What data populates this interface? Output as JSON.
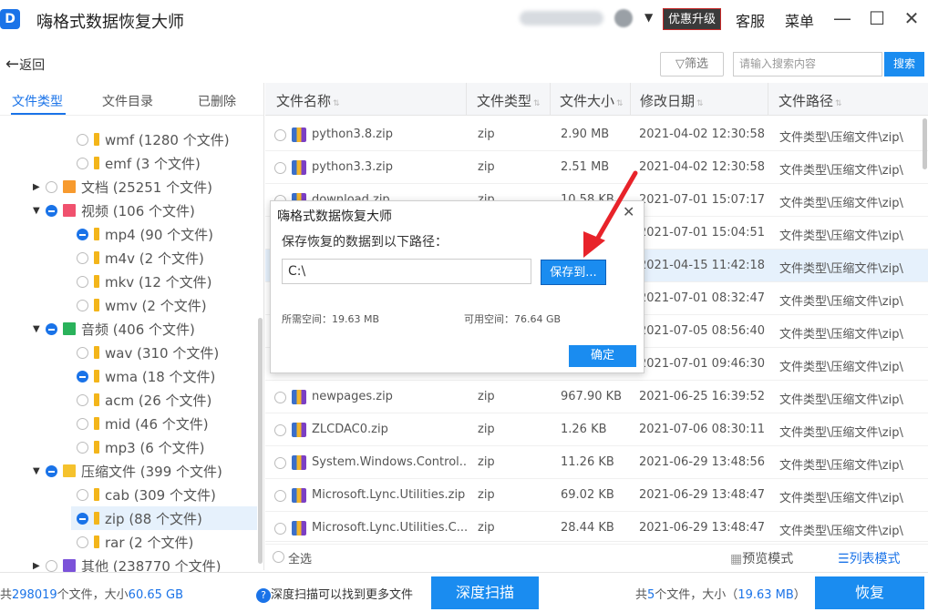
{
  "titlebar": {
    "app_title": "嗨格式数据恢复大师",
    "promo_label": "优惠升级",
    "service_label": "客服",
    "menu_label": "菜单",
    "minimize": "—",
    "maximize": "☐",
    "close": "✕"
  },
  "toolbar": {
    "back_label": "返回",
    "filter_label": "筛选",
    "search_placeholder": "请输入搜索内容",
    "search_button": "搜索"
  },
  "left_tabs": [
    "文件类型",
    "文件目录",
    "已删除"
  ],
  "tree": [
    {
      "label": "wmf (1280 个文件)",
      "level": 2,
      "state": "none",
      "icon": "folder"
    },
    {
      "label": "emf (3 个文件)",
      "level": 2,
      "state": "none",
      "icon": "folder"
    },
    {
      "label": "文档 (25251 个文件)",
      "level": 1,
      "state": "none",
      "icon": "doc",
      "expand": "collapsed"
    },
    {
      "label": "视频 (106 个文件)",
      "level": 1,
      "state": "partial",
      "icon": "video",
      "expand": "expanded"
    },
    {
      "label": "mp4 (90 个文件)",
      "level": 2,
      "state": "partial",
      "icon": "folder"
    },
    {
      "label": "m4v (2 个文件)",
      "level": 2,
      "state": "none",
      "icon": "folder"
    },
    {
      "label": "mkv (12 个文件)",
      "level": 2,
      "state": "none",
      "icon": "folder"
    },
    {
      "label": "wmv (2 个文件)",
      "level": 2,
      "state": "none",
      "icon": "folder"
    },
    {
      "label": "音频 (406 个文件)",
      "level": 1,
      "state": "partial",
      "icon": "audio",
      "expand": "expanded"
    },
    {
      "label": "wav (310 个文件)",
      "level": 2,
      "state": "none",
      "icon": "folder"
    },
    {
      "label": "wma (18 个文件)",
      "level": 2,
      "state": "partial",
      "icon": "folder"
    },
    {
      "label": "acm (26 个文件)",
      "level": 2,
      "state": "none",
      "icon": "folder"
    },
    {
      "label": "mid (46 个文件)",
      "level": 2,
      "state": "none",
      "icon": "folder"
    },
    {
      "label": "mp3 (6 个文件)",
      "level": 2,
      "state": "none",
      "icon": "folder"
    },
    {
      "label": "压缩文件 (399 个文件)",
      "level": 1,
      "state": "partial",
      "icon": "zip",
      "expand": "expanded"
    },
    {
      "label": "cab (309 个文件)",
      "level": 2,
      "state": "none",
      "icon": "folder"
    },
    {
      "label": "zip (88 个文件)",
      "level": 2,
      "state": "partial",
      "icon": "folder",
      "selected": true
    },
    {
      "label": "rar (2 个文件)",
      "level": 2,
      "state": "none",
      "icon": "folder"
    },
    {
      "label": "其他 (238770 个文件)",
      "level": 1,
      "state": "none",
      "icon": "other",
      "expand": "collapsed"
    }
  ],
  "columns": [
    "文件名称",
    "文件类型",
    "文件大小",
    "修改日期",
    "文件路径"
  ],
  "rows": [
    {
      "name": "python3.8.zip",
      "type": "zip",
      "size": "2.90 MB",
      "date": "2021-04-02 12:30:58",
      "path": "文件类型\\压缩文件\\zip\\"
    },
    {
      "name": "python3.3.zip",
      "type": "zip",
      "size": "2.51 MB",
      "date": "2021-04-02 12:30:58",
      "path": "文件类型\\压缩文件\\zip\\"
    },
    {
      "name": "download.zip",
      "type": "zip",
      "size": "10.58 KB",
      "date": "2021-07-01 15:07:17",
      "path": "文件类型\\压缩文件\\zip\\"
    },
    {
      "name": "",
      "type": "",
      "size": "",
      "date": "2021-07-01 15:04:51",
      "path": "文件类型\\压缩文件\\zip\\"
    },
    {
      "name": "",
      "type": "",
      "size": "",
      "date": "2021-04-15 11:42:18",
      "path": "文件类型\\压缩文件\\zip\\",
      "highlight": true
    },
    {
      "name": "",
      "type": "",
      "size": "",
      "date": "2021-07-01 08:32:47",
      "path": "文件类型\\压缩文件\\zip\\"
    },
    {
      "name": "",
      "type": "",
      "size": "",
      "date": "2021-07-05 08:56:40",
      "path": "文件类型\\压缩文件\\zip\\"
    },
    {
      "name": "",
      "type": "",
      "size": "",
      "date": "2021-07-01 09:46:30",
      "path": "文件类型\\压缩文件\\zip\\"
    },
    {
      "name": "newpages.zip",
      "type": "zip",
      "size": "967.90 KB",
      "date": "2021-06-25 16:39:52",
      "path": "文件类型\\压缩文件\\zip\\"
    },
    {
      "name": "ZLCDAC0.zip",
      "type": "zip",
      "size": "1.26 KB",
      "date": "2021-07-06 08:30:11",
      "path": "文件类型\\压缩文件\\zip\\"
    },
    {
      "name": "System.Windows.Control...",
      "type": "zip",
      "size": "11.26 KB",
      "date": "2021-06-29 13:48:56",
      "path": "文件类型\\压缩文件\\zip\\"
    },
    {
      "name": "Microsoft.Lync.Utilities.zip",
      "type": "zip",
      "size": "69.02 KB",
      "date": "2021-06-29 13:48:47",
      "path": "文件类型\\压缩文件\\zip\\"
    },
    {
      "name": "Microsoft.Lync.Utilities.C...",
      "type": "zip",
      "size": "28.44 KB",
      "date": "2021-06-29 13:48:47",
      "path": "文件类型\\压缩文件\\zip\\"
    }
  ],
  "grid_footer": {
    "select_all": "全选",
    "preview_mode": "预览模式",
    "list_mode": "列表模式"
  },
  "status": {
    "total_prefix": "共",
    "total_count": "298019",
    "total_mid": "个文件，大小",
    "total_size": "60.65 GB",
    "deep_hint": "深度扫描可以找到更多文件",
    "deep_scan_button": "深度扫描",
    "sel_prefix": "共",
    "sel_count": "5",
    "sel_mid": "个文件，大小（",
    "sel_size": "19.63 MB",
    "sel_suffix": "）",
    "recover_button": "恢复"
  },
  "dialog": {
    "title": "嗨格式数据恢复大师",
    "prompt": "保存恢复的数据到以下路径：",
    "path_value": "C:\\",
    "save_to_button": "保存到...",
    "required_label": "所需空间：",
    "required_value": "19.63 MB",
    "available_label": "可用空间：",
    "available_value": "76.64 GB",
    "ok_button": "确定",
    "close": "✕"
  },
  "colors": {
    "accent": "#1a8cf0",
    "tab_active": "#1a73e8",
    "arrow": "#e8232a"
  }
}
